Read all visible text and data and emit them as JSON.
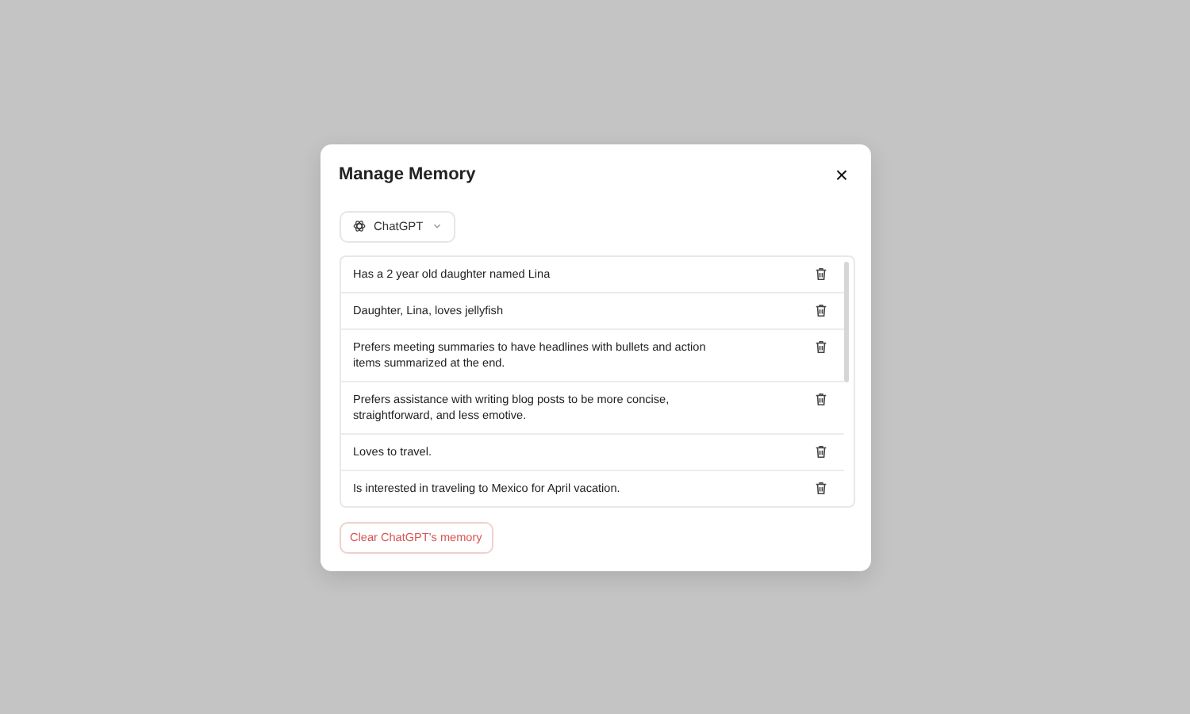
{
  "dialog": {
    "title": "Manage Memory",
    "close": "×"
  },
  "model_selector": {
    "label": "ChatGPT"
  },
  "memories": [
    {
      "text": "Has a 2 year old daughter named Lina"
    },
    {
      "text": "Daughter, Lina, loves jellyfish"
    },
    {
      "text": "Prefers meeting summaries to have headlines with bullets and action items summarized at the end."
    },
    {
      "text": "Prefers assistance with writing blog posts to be more concise, straightforward, and less emotive."
    },
    {
      "text": "Loves to travel."
    },
    {
      "text": "Is interested in traveling to Mexico for April vacation."
    }
  ],
  "clear_button": {
    "label": "Clear ChatGPT's memory"
  }
}
